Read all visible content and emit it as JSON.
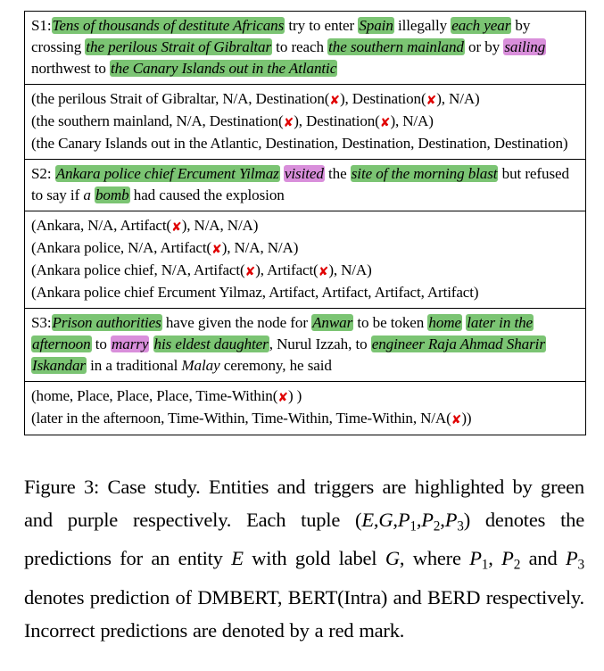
{
  "figure": {
    "rows": [
      {
        "id": "s1-sentence",
        "kind": "sentence",
        "label": "S1:",
        "segments": [
          {
            "text": "Tens of thousands of destitute Africans",
            "style": "green-italic"
          },
          {
            "text": " try to enter ",
            "style": "plain"
          },
          {
            "text": "Spain",
            "style": "green-italic"
          },
          {
            "text": " illegally ",
            "style": "plain"
          },
          {
            "text": "each year",
            "style": "green-italic"
          },
          {
            "text": " by crossing ",
            "style": "plain"
          },
          {
            "text": "the perilous Strait of Gibraltar",
            "style": "green-italic"
          },
          {
            "text": " to reach ",
            "style": "plain"
          },
          {
            "text": "the southern mainland",
            "style": "green-italic"
          },
          {
            "text": " or by ",
            "style": "plain"
          },
          {
            "text": "sailing",
            "style": "purple-italic"
          },
          {
            "text": " northwest to ",
            "style": "plain"
          },
          {
            "text": "the Canary Islands out in the Atlantic",
            "style": "green-italic"
          }
        ]
      },
      {
        "id": "s1-tuples",
        "kind": "tuples",
        "lines": [
          [
            {
              "text": "(the perilous Strait of Gibraltar, N/A, Destination(",
              "style": "plain"
            },
            {
              "text": "✘",
              "style": "xmark"
            },
            {
              "text": "), Destination(",
              "style": "plain"
            },
            {
              "text": "✘",
              "style": "xmark"
            },
            {
              "text": "), N/A)",
              "style": "plain"
            }
          ],
          [
            {
              "text": "(the southern mainland, N/A, Destination(",
              "style": "plain"
            },
            {
              "text": "✘",
              "style": "xmark"
            },
            {
              "text": "), Destination(",
              "style": "plain"
            },
            {
              "text": "✘",
              "style": "xmark"
            },
            {
              "text": "), N/A)",
              "style": "plain"
            }
          ],
          [
            {
              "text": "(the Canary Islands out in the Atlantic, Destination, Destination, Destination, Destination)",
              "style": "plain"
            }
          ]
        ]
      },
      {
        "id": "s2-sentence",
        "kind": "sentence",
        "label": "S2: ",
        "segments": [
          {
            "text": "Ankara police chief Ercument Yilmaz",
            "style": "green-italic"
          },
          {
            "text": " ",
            "style": "plain"
          },
          {
            "text": "visited",
            "style": "purple-italic"
          },
          {
            "text": " the ",
            "style": "plain"
          },
          {
            "text": "site of the morning blast",
            "style": "green-italic"
          },
          {
            "text": " but refused to say if ",
            "style": "plain"
          },
          {
            "text": "a ",
            "style": "italic"
          },
          {
            "text": "bomb",
            "style": "green-italic"
          },
          {
            "text": " had caused the explosion",
            "style": "plain"
          }
        ]
      },
      {
        "id": "s2-tuples",
        "kind": "tuples",
        "lines": [
          [
            {
              "text": "(Ankara, N/A, Artifact(",
              "style": "plain"
            },
            {
              "text": "✘",
              "style": "xmark"
            },
            {
              "text": "), N/A, N/A)",
              "style": "plain"
            }
          ],
          [
            {
              "text": "(Ankara police, N/A, Artifact(",
              "style": "plain"
            },
            {
              "text": "✘",
              "style": "xmark"
            },
            {
              "text": "), N/A, N/A)",
              "style": "plain"
            }
          ],
          [
            {
              "text": "(Ankara police chief, N/A,  Artifact(",
              "style": "plain"
            },
            {
              "text": "✘",
              "style": "xmark"
            },
            {
              "text": "), Artifact(",
              "style": "plain"
            },
            {
              "text": "✘",
              "style": "xmark"
            },
            {
              "text": "), N/A)",
              "style": "plain"
            }
          ],
          [
            {
              "text": "(Ankara police chief Ercument Yilmaz, Artifact, Artifact, Artifact, Artifact)",
              "style": "plain"
            }
          ]
        ]
      },
      {
        "id": "s3-sentence",
        "kind": "sentence",
        "label": "S3:",
        "segments": [
          {
            "text": "Prison authorities",
            "style": "green-italic"
          },
          {
            "text": " have given the node for ",
            "style": "plain"
          },
          {
            "text": "Anwar",
            "style": "green-italic"
          },
          {
            "text": " to be token ",
            "style": "plain"
          },
          {
            "text": "home",
            "style": "green-italic"
          },
          {
            "text": " ",
            "style": "plain"
          },
          {
            "text": "later in the afternoon",
            "style": "green-italic"
          },
          {
            "text": " to ",
            "style": "plain"
          },
          {
            "text": "marry",
            "style": "purple-italic"
          },
          {
            "text": " ",
            "style": "plain"
          },
          {
            "text": "his eldest daughter",
            "style": "green-italic"
          },
          {
            "text": ", Nurul Izzah, to ",
            "style": "plain"
          },
          {
            "text": "engineer Raja Ahmad Sharir Iskandar",
            "style": "green-italic"
          },
          {
            "text": " in a traditional ",
            "style": "plain"
          },
          {
            "text": "Malay",
            "style": "italic"
          },
          {
            "text": " ceremony, he said",
            "style": "plain"
          }
        ]
      },
      {
        "id": "s3-tuples",
        "kind": "tuples",
        "lines": [
          [
            {
              "text": "(home, Place, Place, Place, Time-Within(",
              "style": "plain"
            },
            {
              "text": "✘",
              "style": "xmark"
            },
            {
              "text": ") )",
              "style": "plain"
            }
          ],
          [
            {
              "text": "(later in the afternoon, Time-Within, Time-Within, Time-Within, N/A(",
              "style": "plain"
            },
            {
              "text": "✘",
              "style": "xmark"
            },
            {
              "text": "))",
              "style": "plain"
            }
          ]
        ]
      }
    ]
  },
  "caption": {
    "figure_number": "Figure 3:",
    "text_part_1": " Case study. Entities and triggers are highlighted by green and purple respectively. Each tuple (",
    "sym_E": "E",
    "sym_G": "G",
    "sym_P": "P",
    "sub_1": "1",
    "sub_2": "2",
    "sub_3": "3",
    "text_part_2": ") denotes the predictions for an entity ",
    "text_part_3": " with gold label ",
    "text_part_4": ", where ",
    "text_part_5": " and ",
    "text_part_6": " denotes prediction of DMBERT, BERT(Intra) and BERD respectively. Incorrect predictions are denoted by a red mark."
  },
  "colors": {
    "entity_green": "#7bc473",
    "trigger_purple": "#d98fdb",
    "incorrect_red": "#e00000",
    "border": "#000000"
  }
}
